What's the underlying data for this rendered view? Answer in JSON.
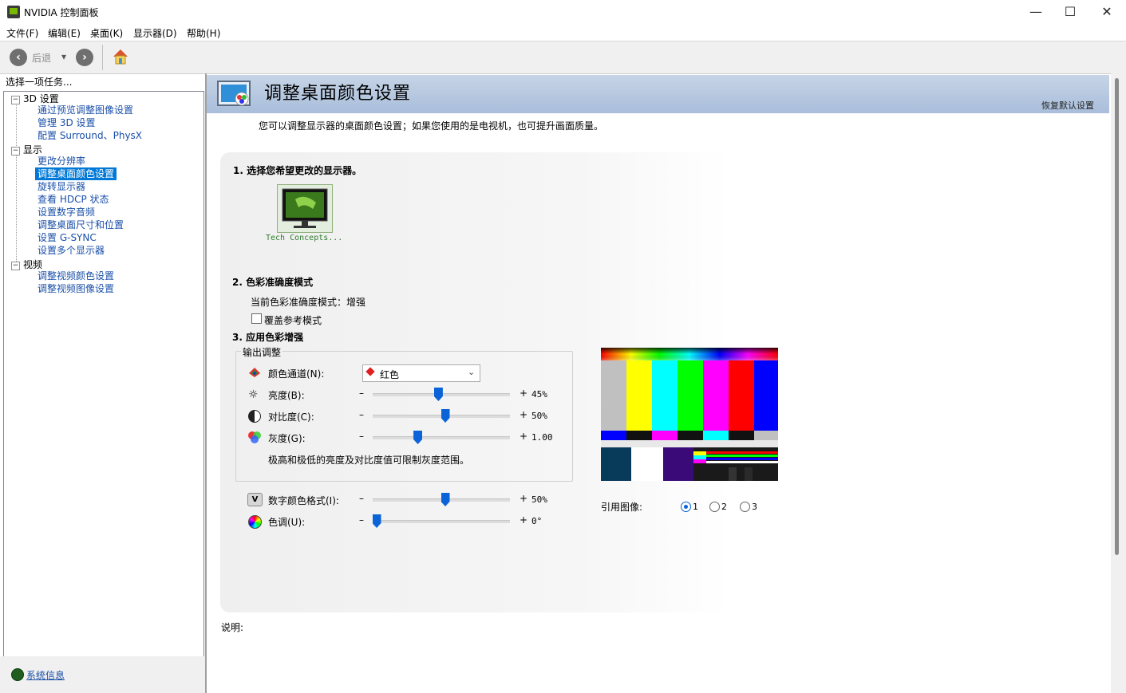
{
  "window": {
    "title": "NVIDIA 控制面板",
    "minimize": "—",
    "maximize": "☐",
    "close": "✕"
  },
  "menu": [
    "文件(F)",
    "编辑(E)",
    "桌面(K)",
    "显示器(D)",
    "帮助(H)"
  ],
  "toolbar": {
    "back_label": "后退",
    "dropdown": "▾"
  },
  "left": {
    "header": "选择一项任务...",
    "tree": {
      "g3d": {
        "label": "3D 设置",
        "items": [
          "通过预览调整图像设置",
          "管理 3D 设置",
          "配置 Surround、PhysX"
        ]
      },
      "display": {
        "label": "显示",
        "items": [
          "更改分辨率",
          "调整桌面颜色设置",
          "旋转显示器",
          "查看 HDCP 状态",
          "设置数字音频",
          "调整桌面尺寸和位置",
          "设置 G-SYNC",
          "设置多个显示器"
        ]
      },
      "video": {
        "label": "视频",
        "items": [
          "调整视频颜色设置",
          "调整视频图像设置"
        ]
      }
    },
    "sysinfo": "系统信息"
  },
  "page": {
    "title": "调整桌面颜色设置",
    "restore": "恢复默认设置",
    "description": "您可以调整显示器的桌面颜色设置；如果您使用的是电视机，也可提升画面质量。",
    "s1": {
      "title": "1. 选择您希望更改的显示器。",
      "monitor": "Tech Concepts..."
    },
    "s2": {
      "title": "2. 色彩准确度模式",
      "current": "当前色彩准确度模式：增强",
      "override": "覆盖参考模式"
    },
    "s3": {
      "title": "3. 应用色彩增强",
      "group": "输出调整",
      "channel_label": "颜色通道(N):",
      "channel_value": "红色",
      "brightness": {
        "label": "亮度(B):",
        "value": "45%",
        "level": 0.45
      },
      "contrast": {
        "label": "对比度(C):",
        "value": "50%",
        "level": 0.5
      },
      "gamma": {
        "label": "灰度(G):",
        "value": "1.00",
        "level": 0.3
      },
      "note": "极高和极低的亮度及对比度值可限制灰度范围。",
      "vibrance": {
        "label": "数字颜色格式(I):",
        "value": "50%",
        "level": 0.5
      },
      "hue": {
        "label": "色调(U):",
        "value": "0°",
        "level": 0.0
      },
      "minus": "–",
      "plus": "+"
    },
    "reference": {
      "label": "引用图像:",
      "options": [
        "1",
        "2",
        "3"
      ],
      "selected": "1"
    },
    "explain_label": "说明:"
  }
}
